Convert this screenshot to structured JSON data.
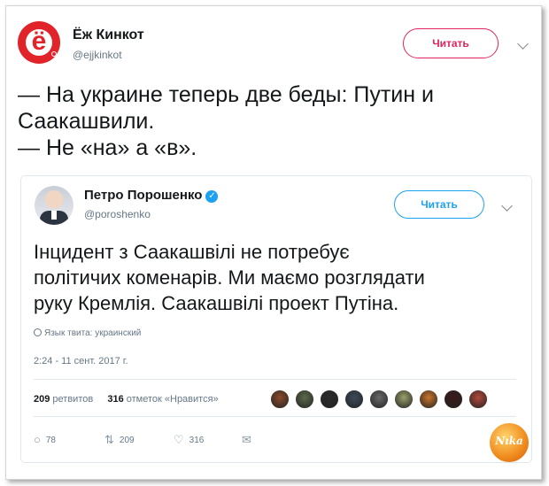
{
  "outer_tweet": {
    "name": "Ёж Кинкот",
    "handle": "@ejjkinkot",
    "avatar_letter": "ё",
    "follow_label": "Читать",
    "text_lines": [
      "— На украине теперь две беды: Путин и",
      "Саакашвили.",
      "— Не «на» а «в»."
    ]
  },
  "quoted_tweet": {
    "name": "Петро Порошенко",
    "verified_icon": "✓",
    "handle": "@poroshenko",
    "follow_label": "Читать",
    "text_lines": [
      "Інцидент з Саакашвілі не потребує",
      "політичих коменарів. Ми маємо розглядати",
      "руку Кремлія. Саакашвілі проект Путіна."
    ],
    "language_note": "Язык твита: украинский",
    "timestamp": "2:24 - 11 сент. 2017 г.",
    "retweets_count": "209",
    "retweets_label": "ретвитов",
    "likes_count": "316",
    "likes_label": "отметок «Нравится»",
    "actions": {
      "reply_icon": "reply-icon",
      "reply_count": "78",
      "retweet_icon": "retweet-icon",
      "retweet_count": "209",
      "like_icon": "heart-icon",
      "like_count": "316",
      "dm_icon": "envelope-icon"
    }
  },
  "liker_colors": [
    "#8a4a2c",
    "#5b6b4a",
    "#2b2b2b",
    "#3d4a5a",
    "#6a6a6a",
    "#9aa06a",
    "#c9742a",
    "#3a1a1a",
    "#b04a3a"
  ],
  "watermark_text": "Nıka",
  "colors": {
    "follow_outer": "#e0245e",
    "follow_inner": "#1da1f2",
    "verified": "#1da1f2",
    "muted": "#657786"
  }
}
